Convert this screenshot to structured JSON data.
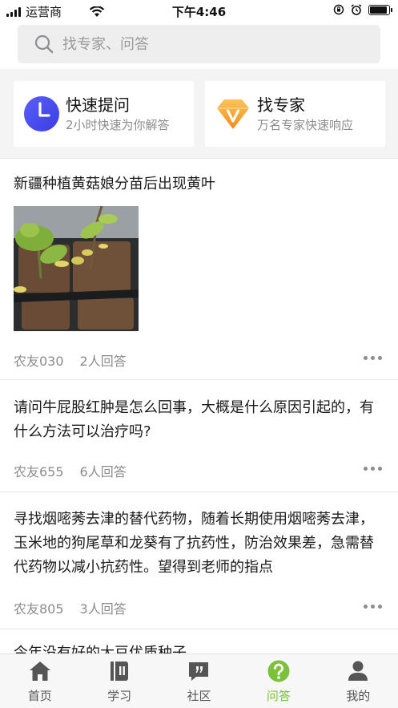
{
  "status_bar": {
    "carrier": "运营商",
    "time": "下午4:46",
    "battery_level": 0.9
  },
  "search": {
    "placeholder": "找专家、问答",
    "icon": "search-icon"
  },
  "quick_actions": [
    {
      "title": "快速提问",
      "subtitle": "2小时快速为你解答",
      "icon": "clock-icon",
      "color": "#4a4ef0"
    },
    {
      "title": "找专家",
      "subtitle": "万名专家快速响应",
      "icon": "diamond-v-icon",
      "color": "#f5a623"
    }
  ],
  "posts": [
    {
      "title": "新疆种植黄菇娘分苗后出现黄叶",
      "author": "农友030",
      "answers": "2人回答",
      "has_image": true
    },
    {
      "title": "请问牛屁股红肿是怎么回事，大概是什么原因引起的，有什么方法可以治疗吗?",
      "author": "农友655",
      "answers": "6人回答",
      "has_image": false
    },
    {
      "title": "寻找烟嘧莠去津的替代药物，随着长期使用烟嘧莠去津，玉米地的狗尾草和龙葵有了抗药性，防治效果差，急需替代药物以减小抗药性。望得到老师的指点",
      "author": "农友805",
      "answers": "3人回答",
      "has_image": false
    },
    {
      "title": "今年没有好的大豆优质种子",
      "author": "",
      "answers": "",
      "has_image": false
    }
  ],
  "tabs": [
    {
      "label": "首页",
      "icon": "home-icon",
      "active": false
    },
    {
      "label": "学习",
      "icon": "book-icon",
      "active": false
    },
    {
      "label": "社区",
      "icon": "chat-quote-icon",
      "active": false
    },
    {
      "label": "问答",
      "icon": "question-circle-icon",
      "active": true
    },
    {
      "label": "我的",
      "icon": "user-icon",
      "active": false
    }
  ],
  "colors": {
    "accent": "#7cc13b",
    "inactive_tab": "#555555",
    "meta_text": "#8c8c8c"
  }
}
